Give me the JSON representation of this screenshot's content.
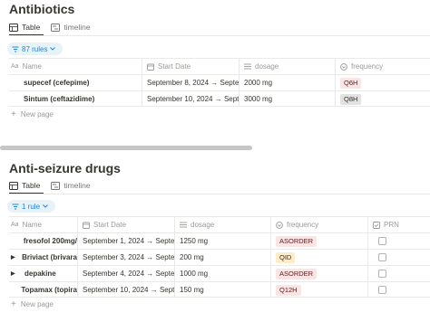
{
  "antibiotics": {
    "title": "Antibiotics",
    "tabs": [
      "Table",
      "timeline"
    ],
    "rules_label": "87 rules",
    "columns": [
      "Name",
      "Start Date",
      "dosage",
      "frequency"
    ],
    "rows": [
      {
        "name": "supecef (cefepime)",
        "date": "September 8, 2024 → Septem",
        "dosage": "2000 mg",
        "frequency": "Q6H"
      },
      {
        "name": "Sintum (ceftazidime)",
        "date": "September 10, 2024 → Septe",
        "dosage": "3000 mg",
        "frequency": "Q8H"
      }
    ],
    "new_page": "New page"
  },
  "antiseizure": {
    "title": "Anti-seizure drugs",
    "tabs": [
      "Table",
      "timeline"
    ],
    "rules_label": "1 rule",
    "columns": [
      "Name",
      "Start Date",
      "dosage",
      "frequency",
      "PRN"
    ],
    "rows": [
      {
        "name": "fresofol 200mg/",
        "date": "September 1, 2024 → Septem",
        "dosage": "1250 mg",
        "frequency": "ASORDER",
        "toggle": ""
      },
      {
        "name": "Briviact (brivara",
        "date": "September 3, 2024 → Septem",
        "dosage": "200 mg",
        "frequency": "QID",
        "toggle": "▶"
      },
      {
        "name": "depakine",
        "date": "September 4, 2024 → Septem",
        "dosage": "1000 mg",
        "frequency": "ASORDER",
        "toggle": "▶"
      },
      {
        "name": "Topamax (topira",
        "date": "September 10, 2024 → Septe",
        "dosage": "150 mg",
        "frequency": "Q12H",
        "toggle": ""
      }
    ],
    "new_page": "New page"
  },
  "tag_colors": {
    "Q6H": {
      "bg": "#fbe4e4",
      "fg": "#5a2323"
    },
    "Q8H": {
      "bg": "#e3e2e0",
      "fg": "#32302c"
    },
    "ASORDER": {
      "bg": "#fbe4e4",
      "fg": "#5a2323"
    },
    "QID": {
      "bg": "#fdecc8",
      "fg": "#402c1b"
    },
    "Q12H": {
      "bg": "#fbe4e4",
      "fg": "#5a2323"
    }
  },
  "icons": {
    "table": "table-icon",
    "timeline": "timeline-icon",
    "filter": "filter-icon",
    "text_prop": "text-property-icon",
    "date_prop": "calendar-icon",
    "number_prop": "list-lines-icon",
    "select_prop": "select-circle-icon",
    "checkbox_prop": "checkbox-property-icon"
  }
}
